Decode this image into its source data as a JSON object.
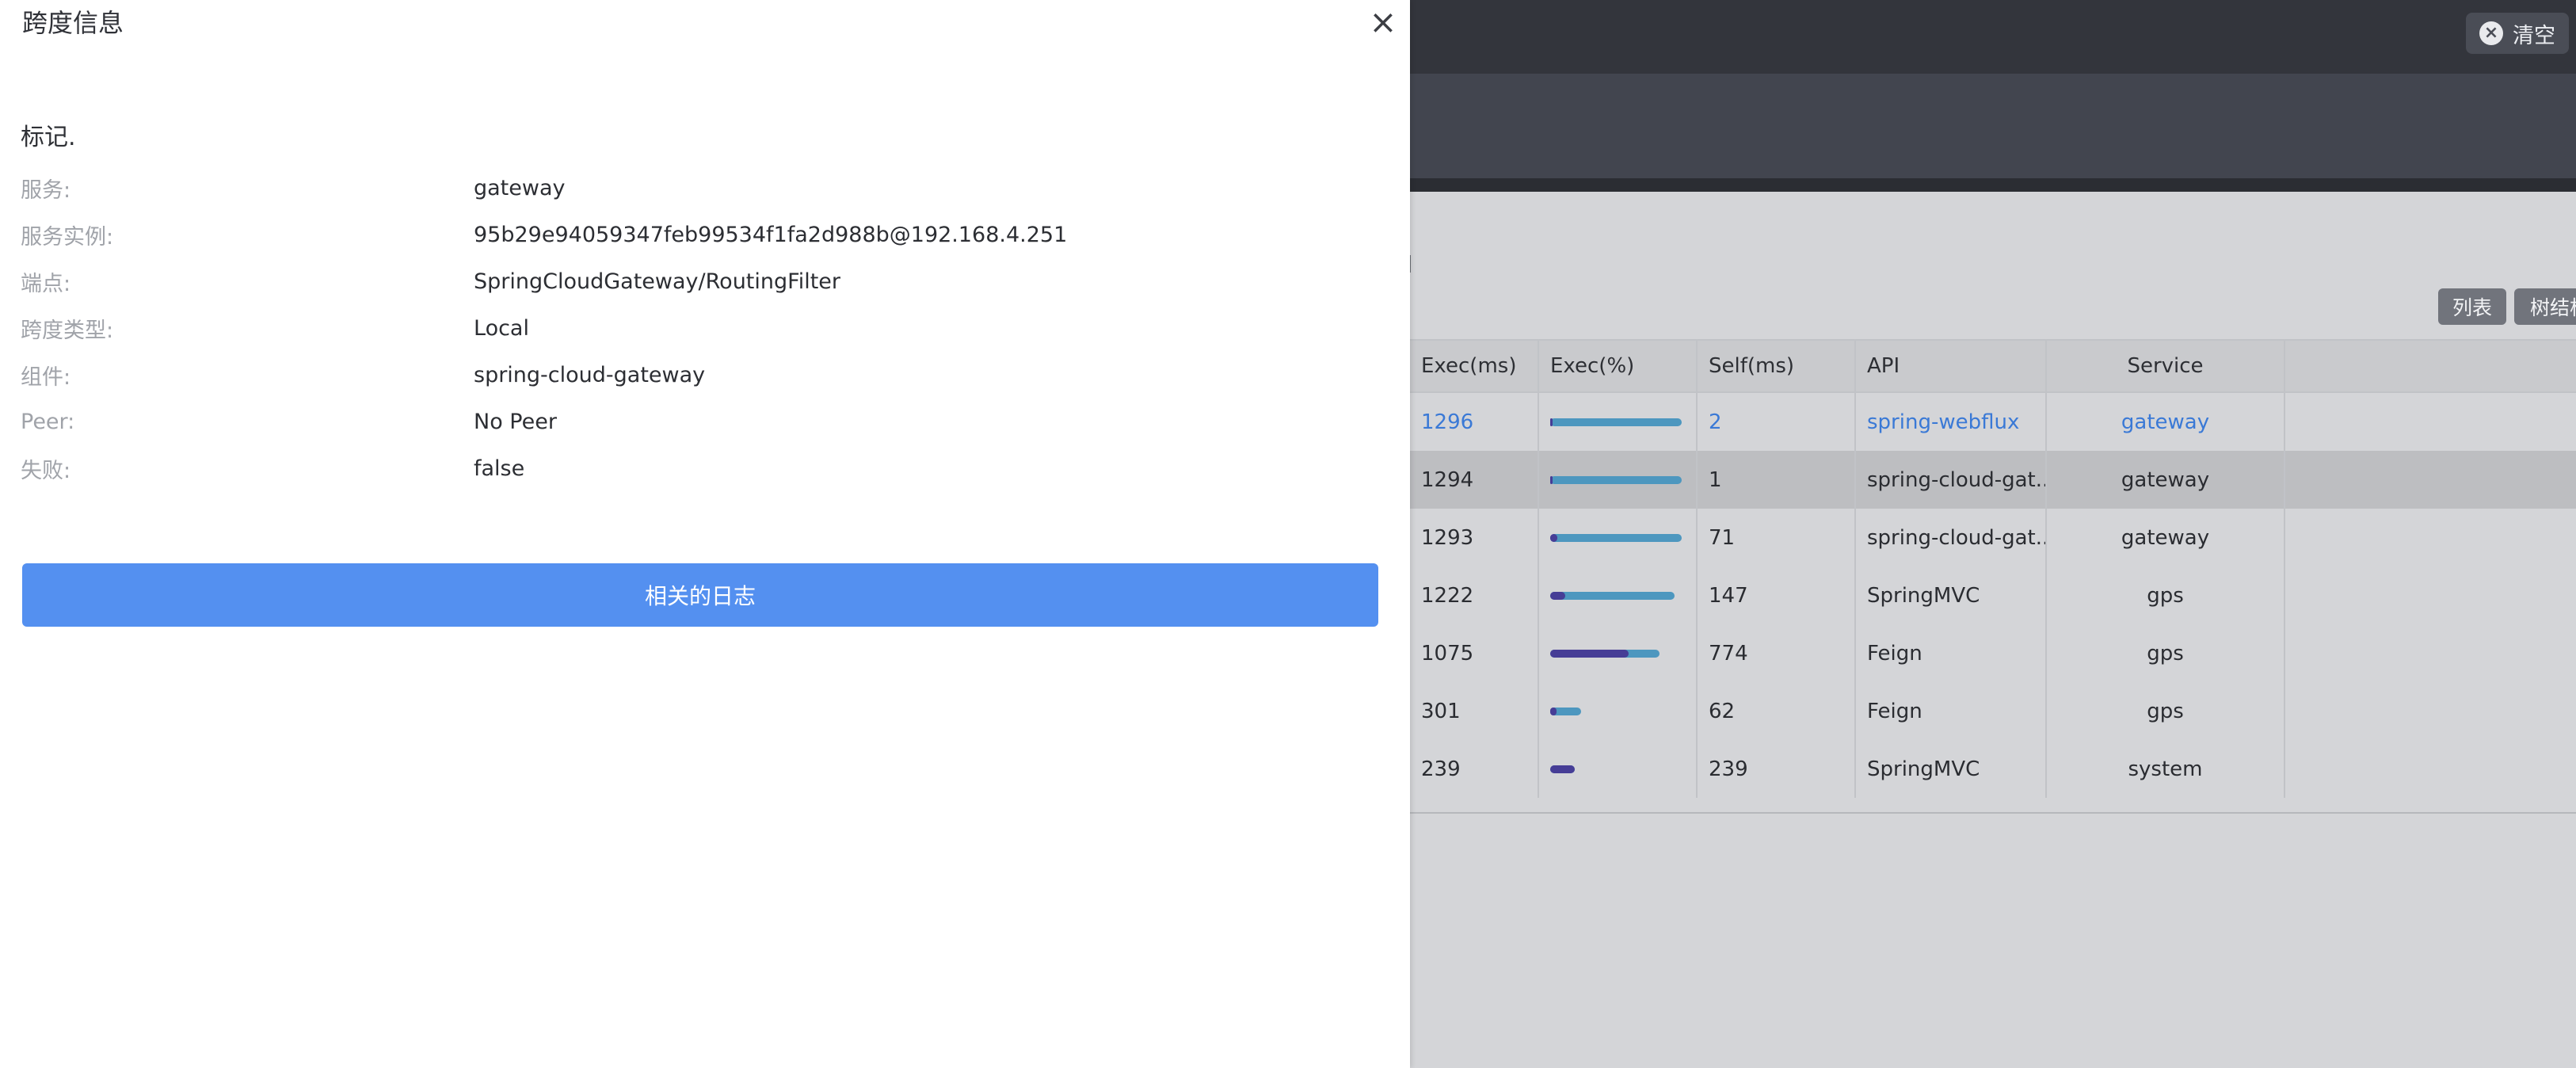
{
  "header": {
    "clear_label": "清空"
  },
  "view_toggle": {
    "list_label": "列表",
    "tree_label": "树结构"
  },
  "table": {
    "columns": [
      "Exec(ms)",
      "Exec(%)",
      "Self(ms)",
      "API",
      "Service"
    ],
    "rows": [
      {
        "exec": "1296",
        "exec_pct": 1.0,
        "self_pct": 0.002,
        "self": "2",
        "api": "spring-webflux",
        "service": "gateway"
      },
      {
        "exec": "1294",
        "exec_pct": 0.998,
        "self_pct": 0.001,
        "self": "1",
        "api": "spring-cloud-gat...",
        "service": "gateway"
      },
      {
        "exec": "1293",
        "exec_pct": 0.998,
        "self_pct": 0.055,
        "self": "71",
        "api": "spring-cloud-gat...",
        "service": "gateway"
      },
      {
        "exec": "1222",
        "exec_pct": 0.943,
        "self_pct": 0.113,
        "self": "147",
        "api": "SpringMVC",
        "service": "gps"
      },
      {
        "exec": "1075",
        "exec_pct": 0.829,
        "self_pct": 0.597,
        "self": "774",
        "api": "Feign",
        "service": "gps"
      },
      {
        "exec": "301",
        "exec_pct": 0.232,
        "self_pct": 0.048,
        "self": "62",
        "api": "Feign",
        "service": "gps"
      },
      {
        "exec": "239",
        "exec_pct": 0.184,
        "self_pct": 0.184,
        "self": "239",
        "api": "SpringMVC",
        "service": "system"
      }
    ]
  },
  "drawer": {
    "title": "跨度信息",
    "close_icon": "close-icon",
    "section_label": "标记.",
    "fields": [
      {
        "key": "服务:",
        "value": "gateway"
      },
      {
        "key": "服务实例:",
        "value": "95b29e94059347feb99534f1fa2d988b@192.168.4.251"
      },
      {
        "key": "端点:",
        "value": "SpringCloudGateway/RoutingFilter"
      },
      {
        "key": "跨度类型:",
        "value": "Local"
      },
      {
        "key": "组件:",
        "value": "spring-cloud-gateway"
      },
      {
        "key": "Peer:",
        "value": "No Peer"
      },
      {
        "key": "失败:",
        "value": "false"
      }
    ],
    "logs_button": "相关的日志"
  },
  "colors": {
    "accent": "#5490f0",
    "exec_bar": "#4d97bf",
    "self_bar": "#463d96",
    "active_text": "#3a79d6"
  }
}
